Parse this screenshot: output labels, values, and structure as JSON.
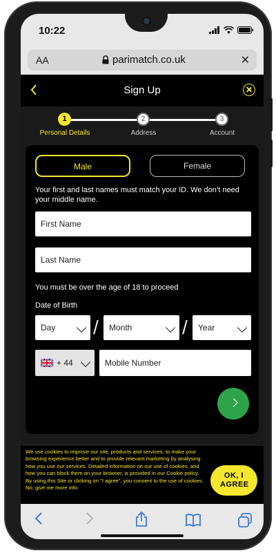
{
  "status_bar": {
    "time": "10:22"
  },
  "browser": {
    "text_size_label": "AA",
    "url": "parimatch.co.uk"
  },
  "header": {
    "title": "Sign Up"
  },
  "steps": [
    {
      "number": "1",
      "label": "Personal Details",
      "active": true
    },
    {
      "number": "2",
      "label": "Address",
      "active": false
    },
    {
      "number": "3",
      "label": "Account",
      "active": false
    }
  ],
  "form": {
    "gender_options": [
      "Male",
      "Female"
    ],
    "selected_gender": "Male",
    "name_note": "Your first and last names must match your ID. We don’t need your middle name.",
    "first_name_placeholder": "First Name",
    "last_name_placeholder": "Last Name",
    "age_note": "You must be over the age of 18 to proceed",
    "dob_label": "Date of Birth",
    "dob_day": "Day",
    "dob_month": "Month",
    "dob_year": "Year",
    "country_code": "+ 44",
    "mobile_placeholder": "Mobile Number"
  },
  "cookie_banner": {
    "text": "We use cookies to improve our site, products and services, to make your browsing experience better and to provide relevant marketing by analysing how you use our services. Detailed information on our use of cookies, and how you can block them on your browser, is provided in our Cookie policy. By using this Site or clicking on \"I agree\", you consent to the use of cookies. No, give me more info",
    "accept_label": "OK, I AGREE"
  },
  "colors": {
    "accent": "#f5e62e",
    "next_button": "#2fa34a",
    "background": "#1a1a1a"
  }
}
